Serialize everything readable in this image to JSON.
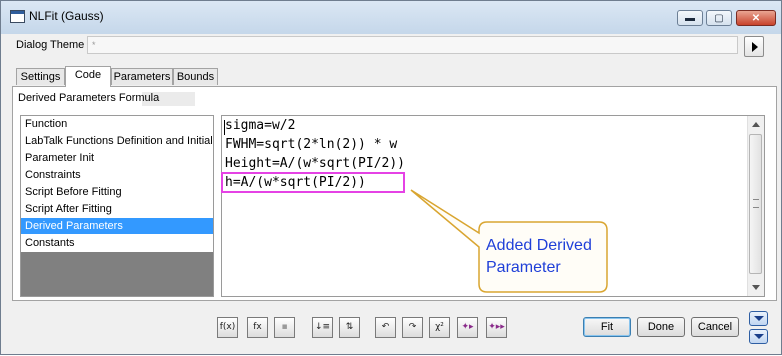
{
  "window": {
    "title": "NLFit (Gauss)",
    "controls": {
      "minimize": "▬",
      "maximize": "▢",
      "close": "✕"
    }
  },
  "dialog_theme": {
    "label": "Dialog Theme",
    "value": "*"
  },
  "tabs": [
    {
      "label": "Settings",
      "active": false
    },
    {
      "label": "Code",
      "active": true
    },
    {
      "label": "Parameters",
      "active": false
    },
    {
      "label": "Bounds",
      "active": false
    }
  ],
  "section_label": "Derived Parameters Formula",
  "code_sections": [
    {
      "label": "Function",
      "selected": false
    },
    {
      "label": "LabTalk Functions Definition and Initializ",
      "selected": false
    },
    {
      "label": "Parameter Init",
      "selected": false
    },
    {
      "label": "Constraints",
      "selected": false
    },
    {
      "label": "Script Before Fitting",
      "selected": false
    },
    {
      "label": "Script After Fitting",
      "selected": false
    },
    {
      "label": "Derived Parameters",
      "selected": true
    },
    {
      "label": "Constants",
      "selected": false
    }
  ],
  "editor": {
    "lines": [
      "sigma=w/2",
      "FWHM=sqrt(2*ln(2)) * w",
      "Height=A/(w*sqrt(PI/2))",
      "h=A/(w*sqrt(PI/2))"
    ]
  },
  "annotation": {
    "text": "Added Derived Parameter",
    "box_color": "#e542e5",
    "bubble_border": "#d9a530",
    "text_color": "#1f3fd8"
  },
  "toolbar_icons": [
    {
      "name": "function-icon",
      "glyph": "f(x)"
    },
    {
      "name": "load-function-icon",
      "glyph": "fx"
    },
    {
      "name": "save-icon",
      "glyph": "▪"
    },
    {
      "name": "sort-icon",
      "glyph": "↓≡"
    },
    {
      "name": "variables-icon",
      "glyph": "⇅"
    },
    {
      "name": "undo-icon",
      "glyph": "↶"
    },
    {
      "name": "redo-icon",
      "glyph": "↷"
    },
    {
      "name": "chi-square-icon",
      "glyph": "χ²"
    },
    {
      "name": "fit-one-iteration-icon",
      "glyph": "✦▸"
    },
    {
      "name": "fit-until-converged-icon",
      "glyph": "✦▸▸"
    }
  ],
  "buttons": {
    "fit": "Fit",
    "done": "Done",
    "cancel": "Cancel"
  }
}
